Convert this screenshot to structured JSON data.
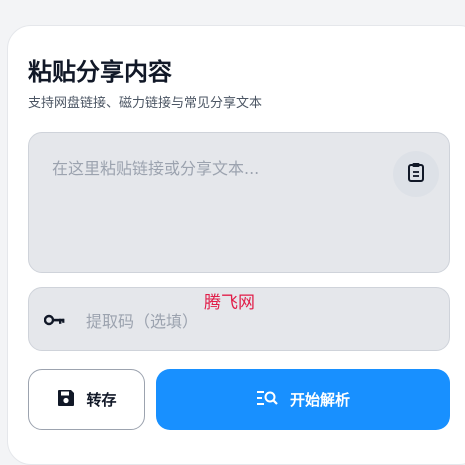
{
  "card": {
    "title": "粘贴分享内容",
    "subtitle": "支持网盘链接、磁力链接与常见分享文本"
  },
  "share_input": {
    "placeholder": "在这里粘贴链接或分享文本..."
  },
  "code_input": {
    "placeholder": "提取码（选填）"
  },
  "watermark": "腾飞网",
  "buttons": {
    "save_label": "转存",
    "parse_label": "开始解析"
  },
  "colors": {
    "primary": "#1890ff",
    "input_bg": "#e5e7eb",
    "watermark": "#e11d48"
  },
  "icons": {
    "paste": "clipboard-icon",
    "key": "key-icon",
    "save": "floppy-disk-icon",
    "parse": "list-search-icon"
  }
}
